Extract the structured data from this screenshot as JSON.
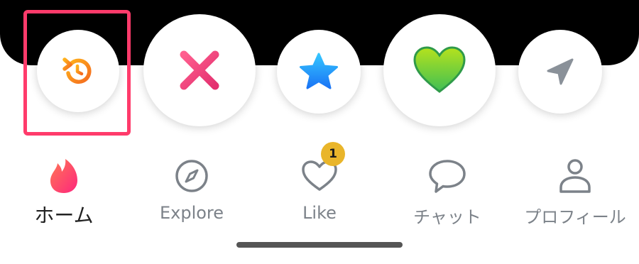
{
  "colors": {
    "rewind": "#f58a1f",
    "nope": "#f0366f",
    "super_like": "#1e95ff",
    "like": "#7bd12c",
    "boost": "#8a9199",
    "highlight_box": "#ff3b6b",
    "badge": "#e9b52a",
    "active_icon": "#fd4f68"
  },
  "action_bar": {
    "buttons": [
      {
        "id": "rewind",
        "icon": "rewind-icon"
      },
      {
        "id": "nope",
        "icon": "x-icon"
      },
      {
        "id": "super_like",
        "icon": "star-icon"
      },
      {
        "id": "like",
        "icon": "heart-icon"
      },
      {
        "id": "boost",
        "icon": "send-icon"
      }
    ]
  },
  "tab_bar": {
    "items": [
      {
        "label": "ホーム",
        "icon": "flame-icon",
        "active": true
      },
      {
        "label": "Explore",
        "icon": "compass-icon",
        "active": false
      },
      {
        "label": "Like",
        "icon": "heart-outline-icon",
        "active": false,
        "badge": "1"
      },
      {
        "label": "チャット",
        "icon": "chat-bubble-icon",
        "active": false
      },
      {
        "label": "プロフィール",
        "icon": "person-icon",
        "active": false
      }
    ]
  }
}
